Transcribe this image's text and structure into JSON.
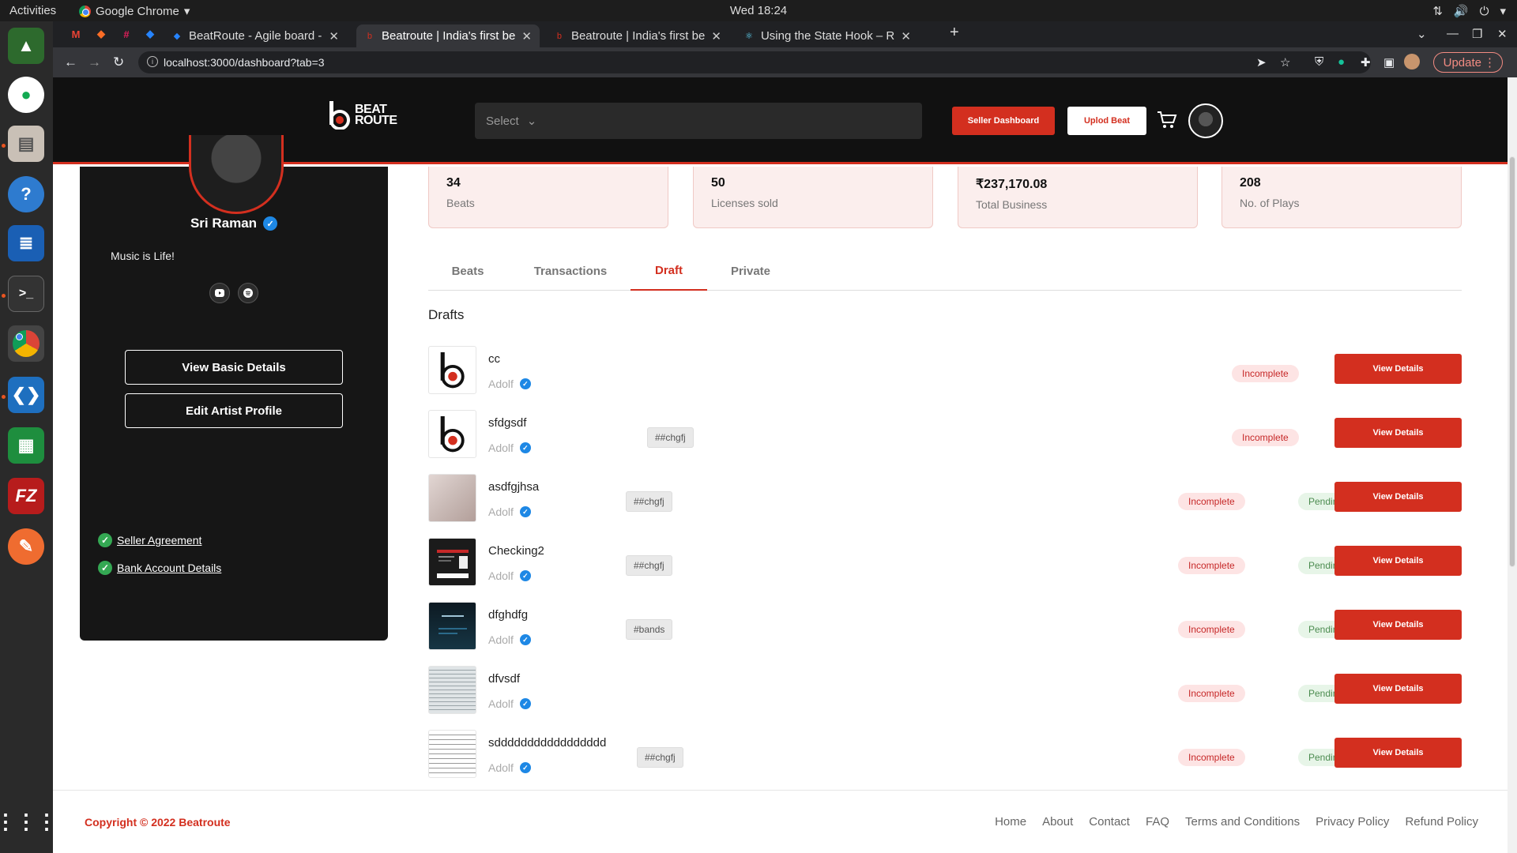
{
  "os": {
    "activities": "Activities",
    "app_menu": "Google Chrome",
    "clock": "Wed 18:24"
  },
  "browser": {
    "tabs": [
      {
        "title": "BeatRoute - Agile board -",
        "active": false
      },
      {
        "title": "Beatroute | India's first be",
        "active": true
      },
      {
        "title": "Beatroute | India's first be",
        "active": false
      },
      {
        "title": "Using the State Hook – Re",
        "active": false
      }
    ],
    "url": "localhost:3000/dashboard?tab=3",
    "update_label": "Update"
  },
  "header": {
    "logo_line1": "BEAT",
    "logo_line2": "ROUTE",
    "select_placeholder": "Select",
    "seller_dashboard": "Seller Dashboard",
    "upload_beat": "Uplod Beat"
  },
  "profile": {
    "name": "Sri Raman",
    "bio": "Music is Life!",
    "view_basic_details": "View Basic Details",
    "edit_artist_profile": "Edit Artist Profile",
    "seller_agreement": "Seller Agreement",
    "bank_account_details": "Bank Account Details"
  },
  "stats": [
    {
      "value": "34",
      "label": "Beats"
    },
    {
      "value": "50",
      "label": "Licenses sold"
    },
    {
      "value": "₹237,170.08",
      "label": "Total Business"
    },
    {
      "value": "208",
      "label": "No. of Plays"
    }
  ],
  "dashboard_tabs": [
    "Beats",
    "Transactions",
    "Draft",
    "Private"
  ],
  "active_tab": "Draft",
  "drafts_title": "Drafts",
  "drafts": [
    {
      "title": "cc",
      "artist": "Adolf",
      "tag": "",
      "status": "Incomplete",
      "approval": "",
      "action": "View Details"
    },
    {
      "title": "sfdgsdf",
      "artist": "Adolf",
      "tag": "##chgfj",
      "status": "Incomplete",
      "approval": "",
      "action": "View Details"
    },
    {
      "title": "asdfgjhsa",
      "artist": "Adolf",
      "tag": "##chgfj",
      "status": "Incomplete",
      "approval": "Pending",
      "action": "View Details"
    },
    {
      "title": "Checking2",
      "artist": "Adolf",
      "tag": "##chgfj",
      "status": "Incomplete",
      "approval": "Pending",
      "action": "View Details"
    },
    {
      "title": "dfghdfg",
      "artist": "Adolf",
      "tag": "#bands",
      "status": "Incomplete",
      "approval": "Pending",
      "action": "View Details"
    },
    {
      "title": "dfvsdf",
      "artist": "Adolf",
      "tag": "",
      "status": "Incomplete",
      "approval": "Pending",
      "action": "View Details"
    },
    {
      "title": "sddddddddddddddddd",
      "artist": "Adolf",
      "tag": "##chgfj",
      "status": "Incomplete",
      "approval": "Pending",
      "action": "View Details"
    }
  ],
  "footer": {
    "copyright": "Copyright © 2022 Beatroute",
    "links": [
      "Home",
      "About",
      "Contact",
      "FAQ",
      "Terms and Conditions",
      "Privacy Policy",
      "Refund Policy"
    ]
  },
  "colors": {
    "brand_red": "#d32f1f",
    "header_bg": "#111111",
    "stat_bg": "#fbeeed"
  }
}
